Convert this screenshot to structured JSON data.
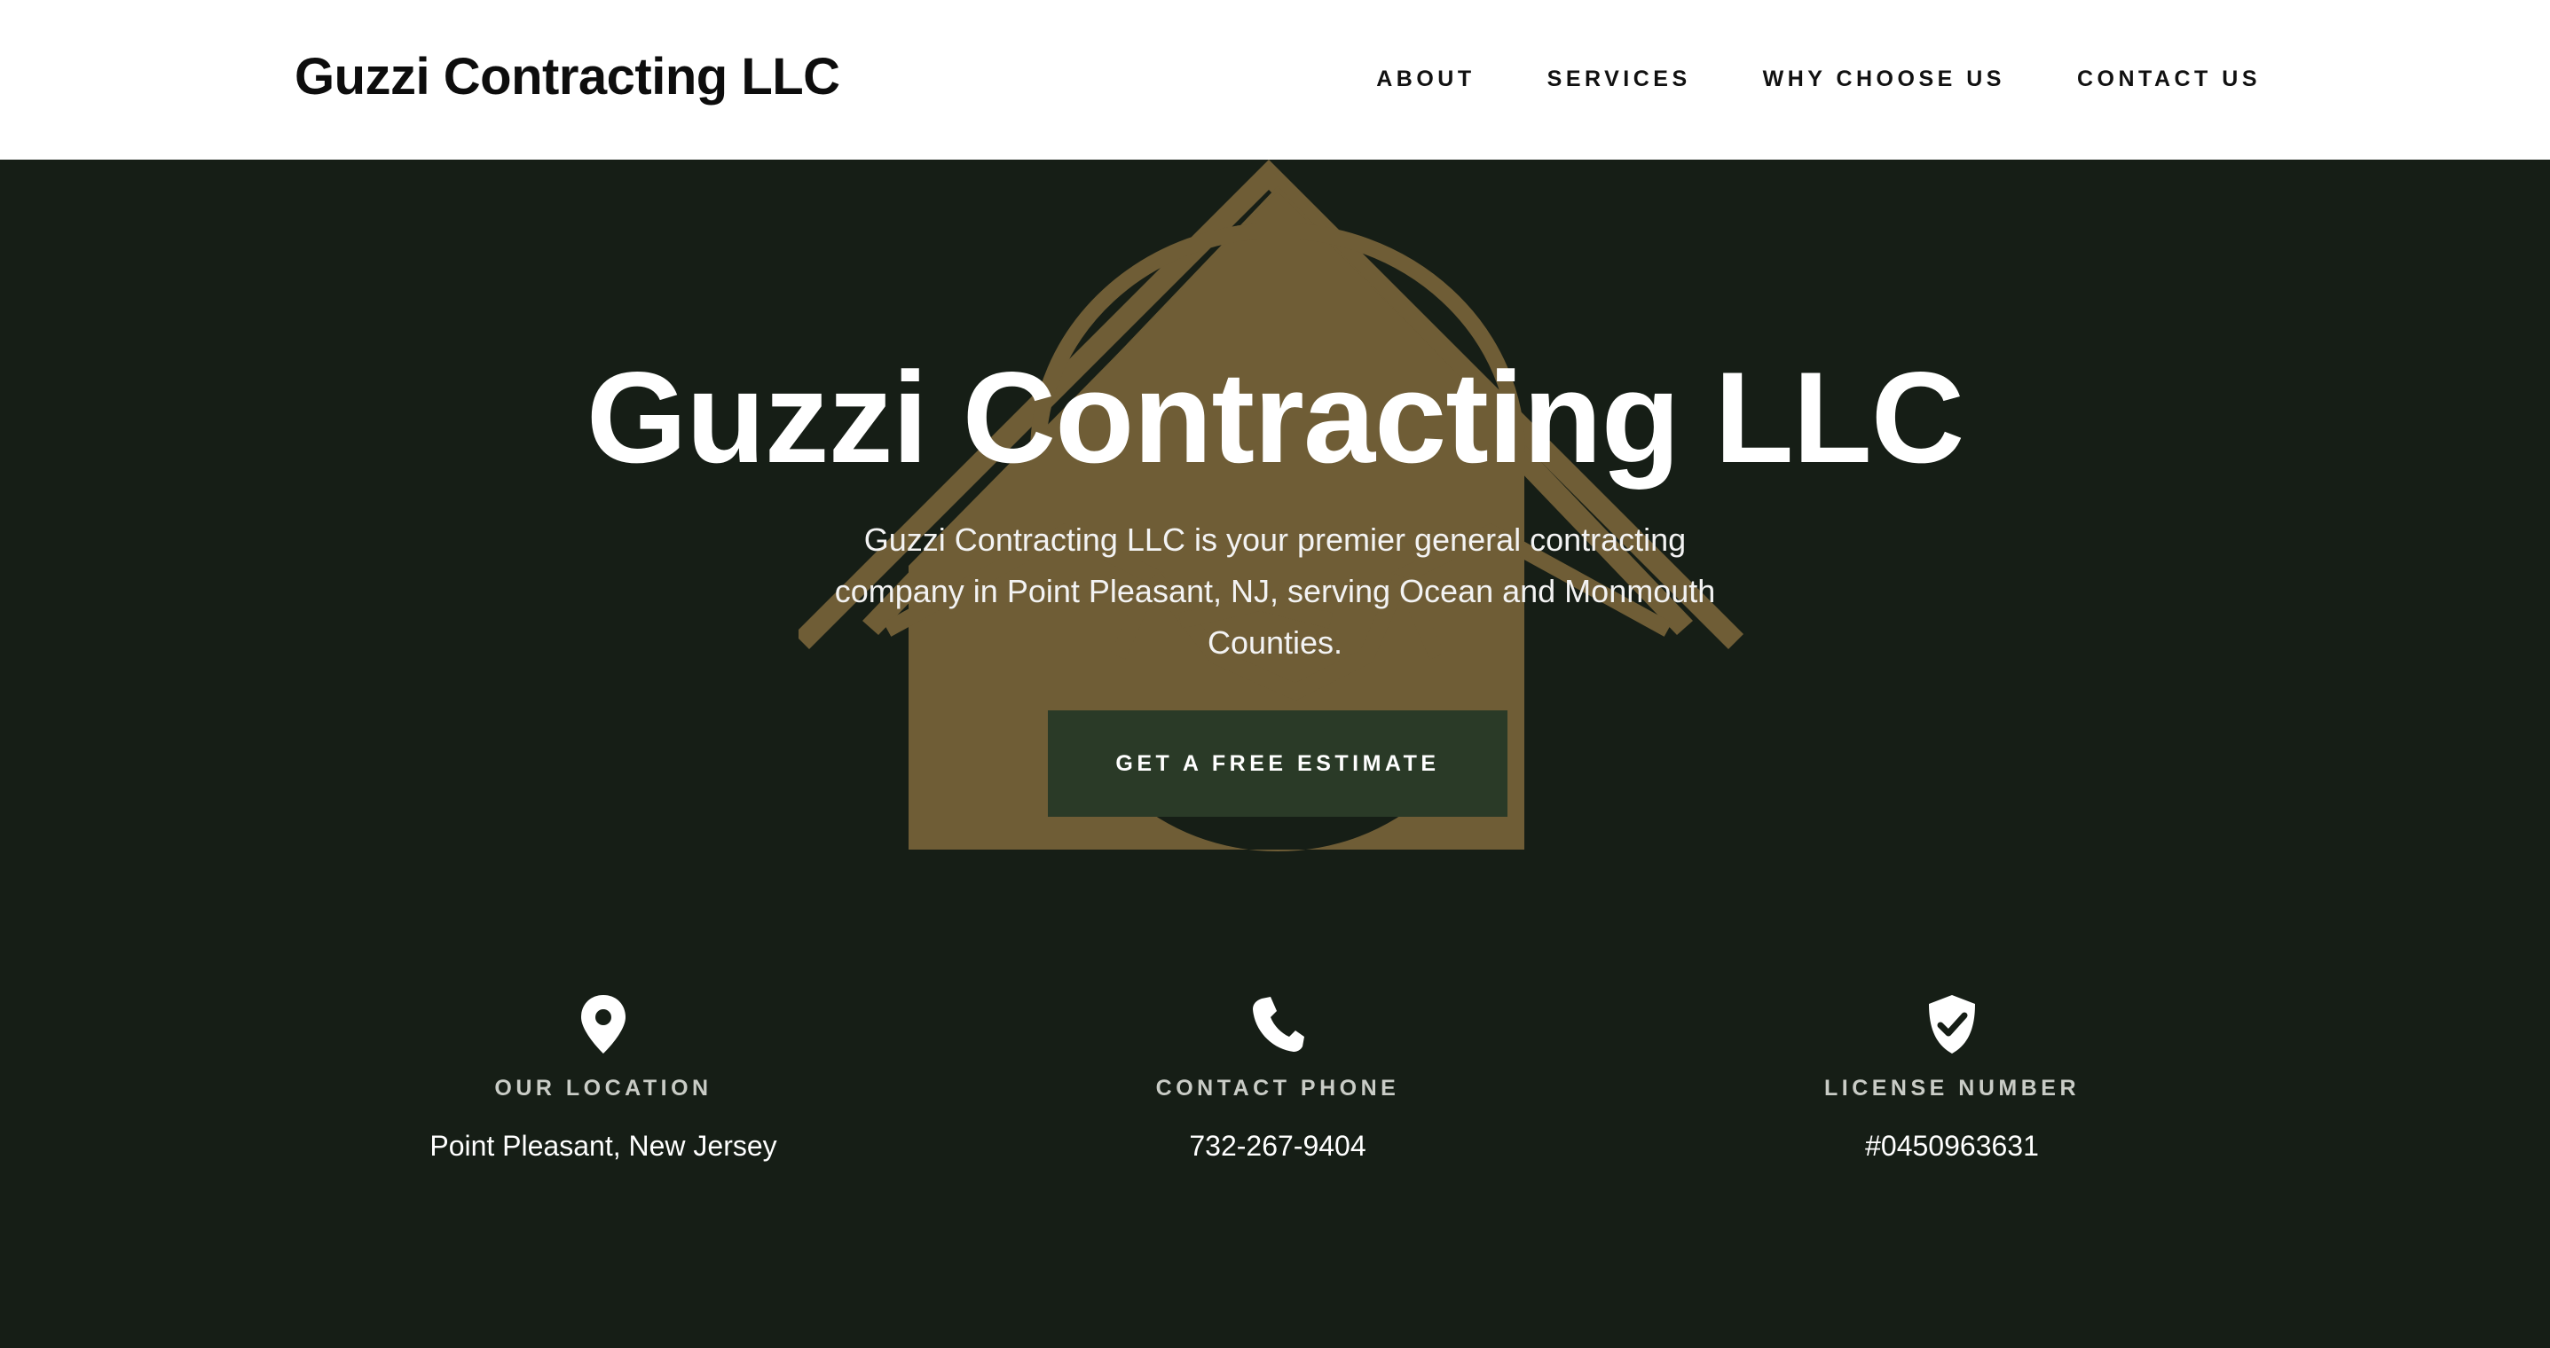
{
  "header": {
    "brand": "Guzzi Contracting LLC",
    "nav": [
      {
        "label": "ABOUT"
      },
      {
        "label": "SERVICES"
      },
      {
        "label": "WHY CHOOSE US"
      },
      {
        "label": "CONTACT US"
      }
    ]
  },
  "hero": {
    "title": "Guzzi Contracting LLC",
    "description": "Guzzi Contracting LLC is your premier general contracting company in Point Pleasant, NJ, serving Ocean and Monmouth Counties.",
    "cta_label": "GET A FREE ESTIMATE",
    "logo_icon": "house-handshake-logo"
  },
  "info": [
    {
      "icon": "map-pin-icon",
      "label": "OUR LOCATION",
      "value": "Point Pleasant, New Jersey"
    },
    {
      "icon": "phone-icon",
      "label": "CONTACT PHONE",
      "value": "732-267-9404"
    },
    {
      "icon": "shield-check-icon",
      "label": "LICENSE NUMBER",
      "value": "#0450963631"
    }
  ],
  "colors": {
    "hero_background": "#161e16",
    "cta_background": "#2a3a27",
    "logo_gold": "#6f5d36",
    "header_background": "#ffffff"
  }
}
